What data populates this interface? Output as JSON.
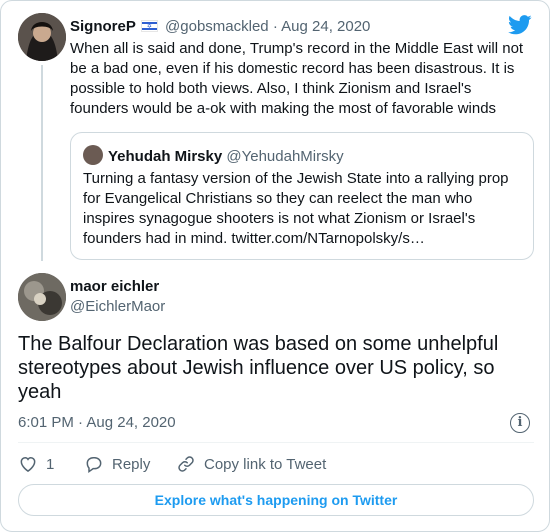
{
  "parent_tweet": {
    "name": "SignoreP",
    "handle": "@gobsmackled",
    "separator": "·",
    "date": "Aug 24, 2020",
    "text": "When all is said and done, Trump's record in the Middle East will not be a bad one, even if his domestic record has been disastrous. It is possible to hold both views. Also, I think Zionism and Israel's founders would be a-ok with making the most of favorable winds",
    "flag_icon": "israel-flag-icon"
  },
  "quoted_tweet": {
    "name": "Yehudah Mirsky",
    "handle": "@YehudahMirsky",
    "text": "Turning a fantasy version of the Jewish State into a rallying prop for Evangelical Christians so they can reelect the man who inspires synagogue shooters is not what Zionism or Israel's founders had in mind. twitter.com/NTarnopolsky/s…"
  },
  "main_tweet": {
    "name": "maor eichler",
    "handle": "@EichlerMaor",
    "text": "The Balfour Declaration was based on some unhelpful stereotypes about Jewish influence over US policy, so yeah",
    "timestamp": "6:01 PM · Aug 24, 2020"
  },
  "actions": {
    "like_count": "1",
    "reply_label": "Reply",
    "copy_link_label": "Copy link to Tweet"
  },
  "explore_label": "Explore what's happening on Twitter",
  "colors": {
    "accent": "#1d9bf0",
    "muted": "#536471",
    "border": "#cfd9de"
  }
}
